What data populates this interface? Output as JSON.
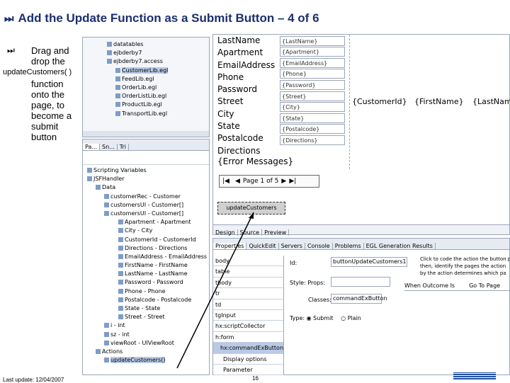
{
  "slide": {
    "title": "Add the Update Function as a Submit Button – 4 of 6",
    "title_symbol": "⏭",
    "bullet_symbol": "⏭",
    "bullet_line1": "Drag and",
    "bullet_line2": "drop the",
    "code": "updateCustomers( )",
    "bullet_rest": [
      "function",
      "onto the",
      "page, to",
      "become a",
      "submit",
      "button"
    ],
    "footer_left": "Last update: 12/04/2007",
    "page_number": "16"
  },
  "tree_top": [
    "datatables",
    "ejbderby7",
    "ejbderby7.access",
    "CustomerLib.egl",
    "FeedLib.egl",
    "OrderLib.egl",
    "OrderListLib.egl",
    "ProductLib.egl",
    "TransportLib.egl"
  ],
  "page_data_tabs": [
    "Pa...",
    "Sn...",
    "Tri"
  ],
  "page_data_tree": [
    "Scripting Variables",
    "JSFHandler",
    "Data",
    "customerRec - Customer",
    "customersUI - Customer[]",
    "customersUI - Customer[]",
    "Apartment - Apartment",
    "City - City",
    "CustomerId - CustomerId",
    "Directions - Directions",
    "EmailAddress - EmailAddress",
    "FirstName - FirstName",
    "LastName - LastName",
    "Password - Password",
    "Phone - Phone",
    "Postalcode - Postalcode",
    "State - State",
    "Street - Street",
    "i - int",
    "sz - int",
    "viewRoot - UIViewRoot",
    "Actions",
    "updateCustomers()"
  ],
  "form": {
    "labels": [
      "LastName",
      "Apartment",
      "EmailAddress",
      "Phone",
      "Password",
      "Street",
      "City",
      "State",
      "Postalcode",
      "Directions"
    ],
    "values": [
      "{LastName}",
      "{Apartment}",
      "{EmailAddress}",
      "{Phone}",
      "{Password}",
      "{Street}",
      "{City}",
      "{State}",
      "{Postalcode}",
      "{Directions}"
    ],
    "error": "{Error Messages}",
    "columns": [
      "{CustomerId}",
      "{FirstName}",
      "{LastName}"
    ],
    "pager": "Page 1 of 5",
    "button": "updateCustomers"
  },
  "design_tabs": [
    "Design",
    "Source",
    "Preview"
  ],
  "view_tabs": [
    "Properties",
    "QuickEdit",
    "Servers",
    "Console",
    "Problems",
    "EGL Generation Results"
  ],
  "props_list": [
    "body",
    "table",
    "tbody",
    "tr",
    "td",
    "tgInput",
    "hx:scriptCollector",
    "h:form"
  ],
  "props_sub": [
    "hx:commandExButton",
    "Display options",
    "Parameter"
  ],
  "props": {
    "id_label": "Id:",
    "id_value": "buttonUpdateCustomers1",
    "style_label": "Style: Props:",
    "classes_label": "Classes:",
    "classes_value": "commandExButton",
    "type_label": "Type:",
    "type_submit": "Submit",
    "type_plain": "Plain",
    "help": [
      "Click to code the action the button p",
      "then, identify the pages the action",
      "by the action determines which pa"
    ],
    "col_when": "When Outcome Is",
    "col_go": "Go To Page"
  }
}
